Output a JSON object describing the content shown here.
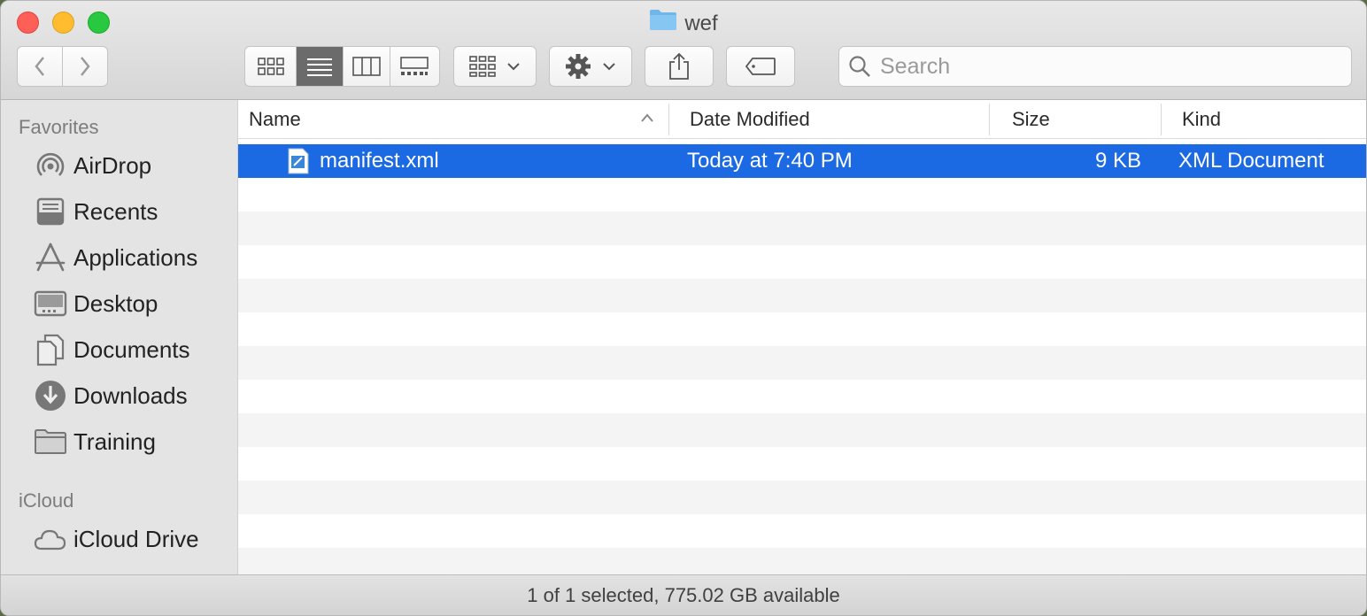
{
  "window": {
    "title": "wef"
  },
  "toolbar": {
    "back_icon": "chevron-left-icon",
    "forward_icon": "chevron-right-icon",
    "view_modes": [
      "icon-view",
      "list-view",
      "column-view",
      "gallery-view"
    ],
    "active_view": "list-view",
    "group_icon": "group-by-icon",
    "action_icon": "gear-icon",
    "share_icon": "share-icon",
    "tag_icon": "tag-icon"
  },
  "search": {
    "placeholder": "Search",
    "value": ""
  },
  "sidebar": {
    "favorites_heading": "Favorites",
    "favorites": [
      {
        "label": "AirDrop",
        "icon": "airdrop-icon"
      },
      {
        "label": "Recents",
        "icon": "recents-icon"
      },
      {
        "label": "Applications",
        "icon": "applications-icon"
      },
      {
        "label": "Desktop",
        "icon": "desktop-icon"
      },
      {
        "label": "Documents",
        "icon": "documents-icon"
      },
      {
        "label": "Downloads",
        "icon": "downloads-icon"
      },
      {
        "label": "Training",
        "icon": "folder-icon"
      }
    ],
    "icloud_heading": "iCloud",
    "icloud": [
      {
        "label": "iCloud Drive",
        "icon": "icloud-icon"
      }
    ]
  },
  "columns": {
    "name": "Name",
    "date_modified": "Date Modified",
    "size": "Size",
    "kind": "Kind"
  },
  "files": [
    {
      "name": "manifest.xml",
      "date_modified": "Today at 7:40 PM",
      "size": "9 KB",
      "kind": "XML Document",
      "selected": true,
      "icon": "xml-file-icon"
    }
  ],
  "status": {
    "text": "1 of 1 selected, 775.02 GB available"
  },
  "colors": {
    "selection": "#1b6ae3",
    "close": "#fe5f57",
    "minimize": "#febc2e",
    "maximize": "#28c840",
    "folder": "#6fb6ea"
  }
}
